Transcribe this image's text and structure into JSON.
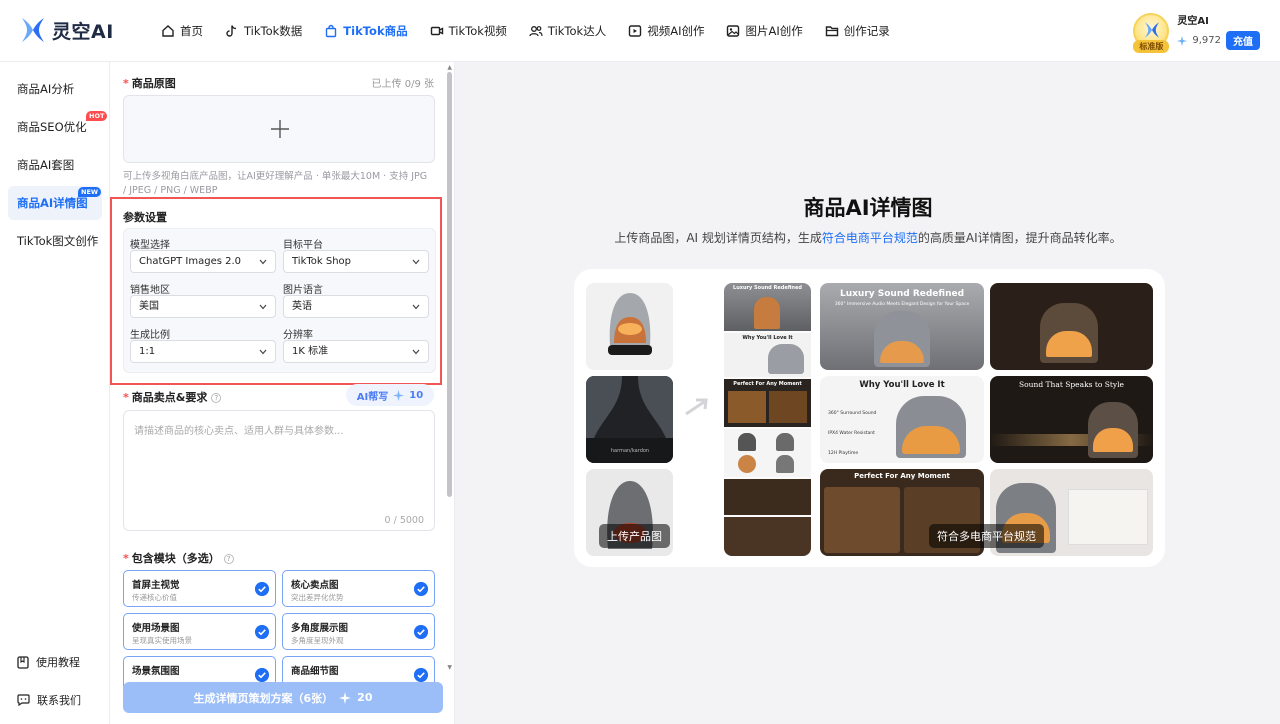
{
  "brand": {
    "name": "灵空AI"
  },
  "nav": [
    {
      "label": "首页",
      "icon": "home-icon"
    },
    {
      "label": "TikTok数据",
      "icon": "tiktok-icon"
    },
    {
      "label": "TikTok商品",
      "icon": "shopping-bag-icon",
      "active": true
    },
    {
      "label": "TikTok视频",
      "icon": "video-icon"
    },
    {
      "label": "TikTok达人",
      "icon": "users-icon"
    },
    {
      "label": "视频AI创作",
      "icon": "video-ai-icon"
    },
    {
      "label": "图片AI创作",
      "icon": "image-icon"
    },
    {
      "label": "创作记录",
      "icon": "folder-icon"
    }
  ],
  "user": {
    "name": "灵空AI",
    "plan": "标准版",
    "credits": "9,972",
    "recharge_label": "充值"
  },
  "sidebar": {
    "items": [
      {
        "label": "商品AI分析"
      },
      {
        "label": "商品SEO优化",
        "tag": "HOT"
      },
      {
        "label": "商品AI套图"
      },
      {
        "label": "商品AI详情图",
        "tag": "NEW",
        "active": true
      },
      {
        "label": "TikTok图文创作"
      }
    ],
    "bottom": [
      {
        "label": "使用教程",
        "icon": "book-icon"
      },
      {
        "label": "联系我们",
        "icon": "chat-icon"
      }
    ]
  },
  "form": {
    "upload": {
      "label": "商品原图",
      "count": "已上传 0/9 张",
      "hint": "可上传多视角白底产品图，让AI更好理解产品 · 单张最大10M · 支持 JPG / JPEG / PNG / WEBP"
    },
    "params": {
      "title": "参数设置",
      "model_label": "模型选择",
      "model_value": "ChatGPT Images 2.0",
      "platform_label": "目标平台",
      "platform_value": "TikTok Shop",
      "region_label": "销售地区",
      "region_value": "美国",
      "language_label": "图片语言",
      "language_value": "英语",
      "ratio_label": "生成比例",
      "ratio_value": "1:1",
      "resolution_label": "分辨率",
      "resolution_value": "1K 标准"
    },
    "selling": {
      "label": "商品卖点&要求",
      "ai_label": "AI帮写",
      "ai_cost": "10",
      "placeholder": "请描述商品的核心卖点、适用人群与具体参数...",
      "count": "0 / 5000"
    },
    "modules": {
      "label": "包含模块（多选）",
      "items": [
        {
          "title": "首屏主视觉",
          "desc": "传递核心价值"
        },
        {
          "title": "核心卖点图",
          "desc": "突出差异化优势"
        },
        {
          "title": "使用场景图",
          "desc": "呈现真实使用场景"
        },
        {
          "title": "多角度展示图",
          "desc": "多角度呈现外观"
        },
        {
          "title": "场景氛围图",
          "desc": ""
        },
        {
          "title": "商品细节图",
          "desc": ""
        }
      ]
    },
    "generate": {
      "label": "生成详情页策划方案（6张）",
      "cost": "20"
    }
  },
  "main": {
    "title": "商品AI详情图",
    "subtitle_pre": "上传商品图，AI 规划详情页结构，生成",
    "subtitle_hl": "符合电商平台规范",
    "subtitle_post": "的高质量AI详情图，提升商品转化率。",
    "caption_upload": "上传产品图",
    "caption_platform": "符合多电商平台规范",
    "img_texts": {
      "luxury": "Luxury Sound Redefined",
      "luxury_sub": "360° Immersive Audio Meets Elegant Design for Your Space",
      "why": "Why You'll Love It",
      "sound": "Sound That Speaks to Style",
      "perfect": "Perfect For Any Moment",
      "brand": "harman/kardon",
      "feat1": "360° Surround Sound",
      "feat2": "IPX4 Water Resistant",
      "feat3": "12H Playtime"
    }
  }
}
